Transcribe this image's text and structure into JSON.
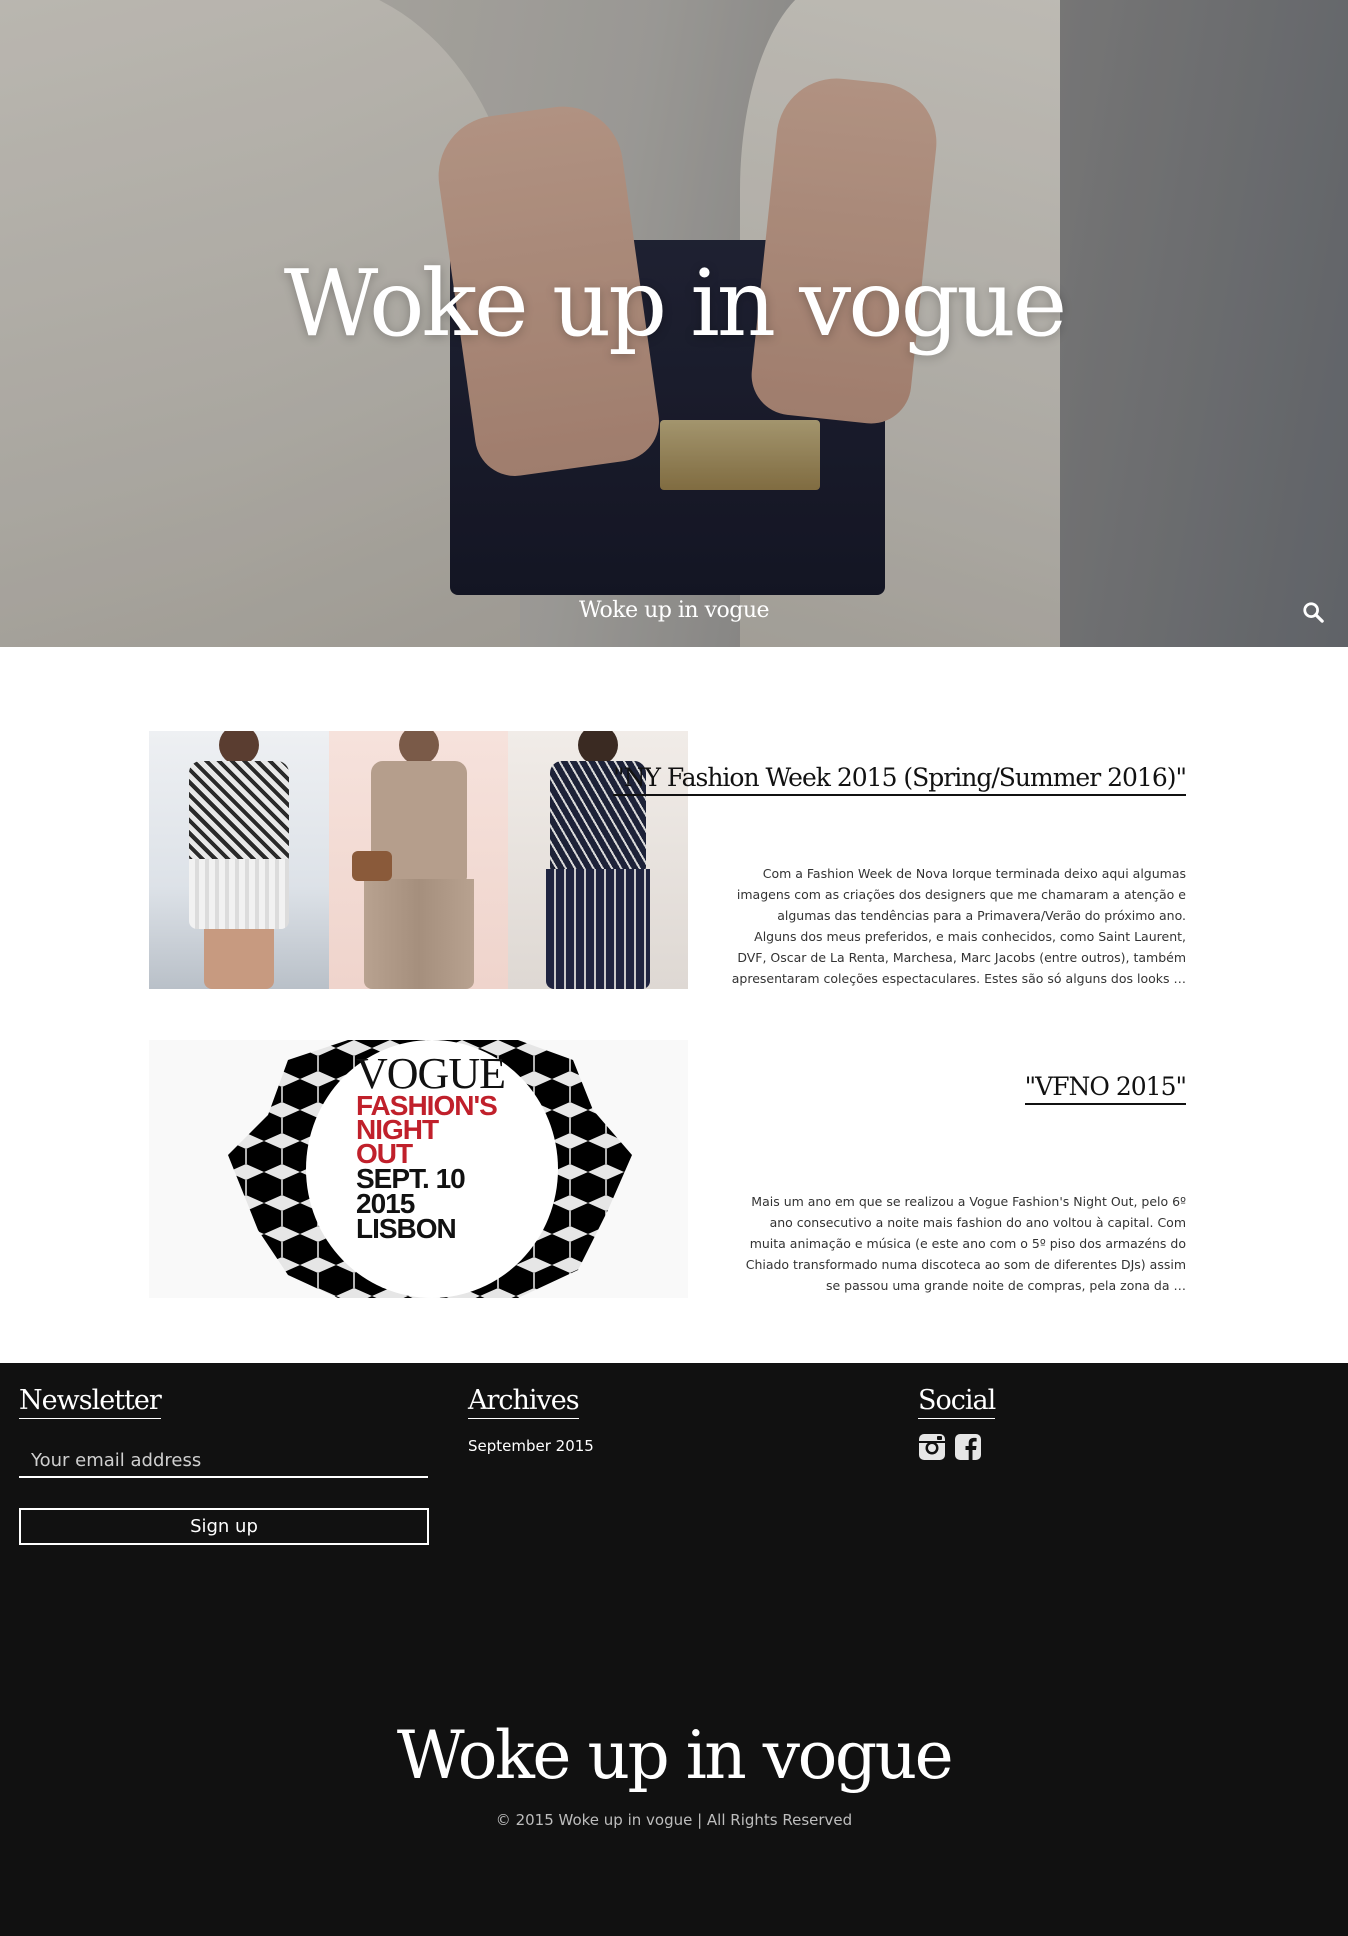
{
  "site": {
    "hero_title": "Woke up in vogue",
    "nav_title": "Woke up in vogue"
  },
  "posts": [
    {
      "title": "\"NY Fashion Week 2015 (Spring/Summer 2016)\"",
      "excerpt": "Com a Fashion Week de Nova Iorque terminada deixo aqui algumas imagens com as criações dos designers que me chamaram a atenção e algumas das tendências para a Primavera/Verão do próximo ano. Alguns dos meus preferidos,  e mais conhecidos, como Saint Laurent, DVF, Oscar de La Renta, Marchesa, Marc Jacobs (entre outros), também apresentaram coleções espectaculares. Estes são só alguns dos looks …"
    },
    {
      "title": "\"VFNO 2015\"",
      "excerpt": "Mais um ano em que se realizou a Vogue Fashion's Night Out, pelo 6º ano consecutivo a noite mais fashion do ano voltou à capital. Com muita animação e música (e este ano com o 5º piso dos armazéns do Chiado transformado numa discoteca ao som de diferentes DJs) assim se passou uma grande noite de compras, pela zona da …",
      "image_text": {
        "brand": "VOGUE",
        "line1": "FASHION'S",
        "line2": "NIGHT",
        "line3": "OUT",
        "line4": "SEPT. 10",
        "line5": "2015",
        "line6": "LISBON"
      }
    }
  ],
  "footer": {
    "newsletter": {
      "title": "Newsletter",
      "placeholder": "Your email address",
      "button_label": "Sign up"
    },
    "archives": {
      "title": "Archives",
      "items": [
        "September 2015"
      ]
    },
    "social": {
      "title": "Social",
      "icons": [
        "instagram-icon",
        "facebook-icon"
      ]
    },
    "site_title": "Woke up in vogue",
    "copyright": "© 2015 Woke up in vogue | All Rights Reserved"
  },
  "colors": {
    "footer_bg": "#111111",
    "vfno_red": "#c0202b"
  }
}
